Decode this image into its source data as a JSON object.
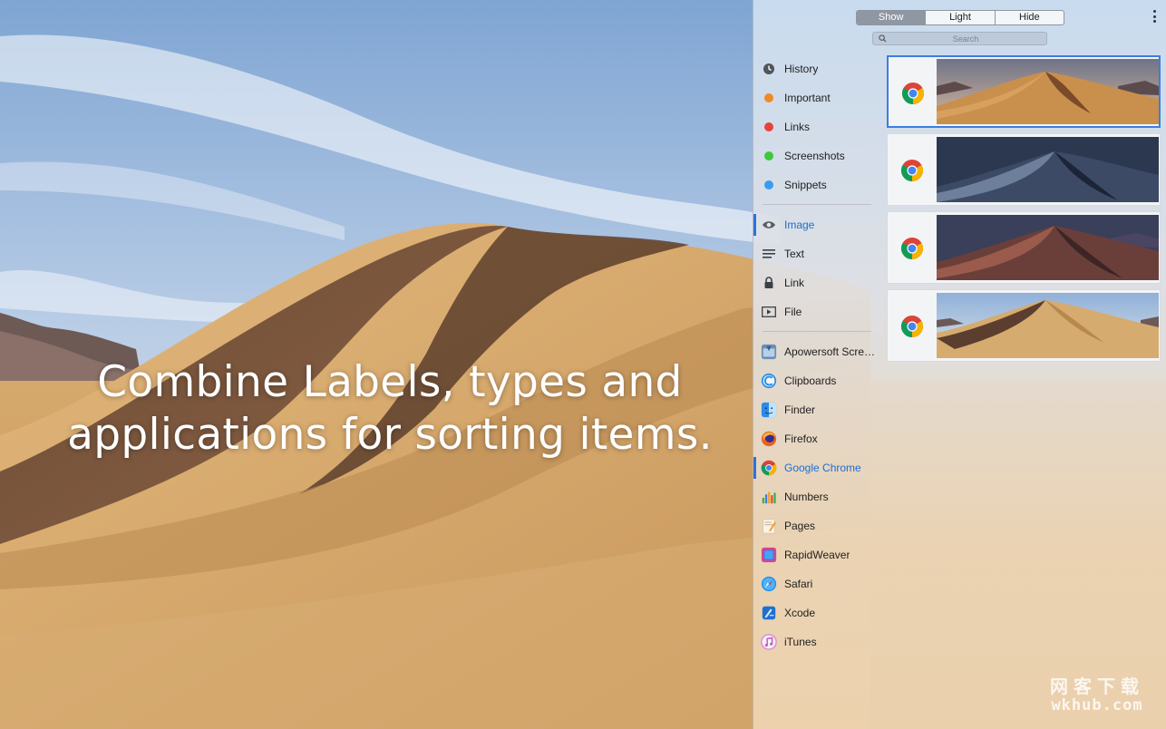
{
  "caption": {
    "line1": "Combine Labels, types and",
    "line2": "applications for sorting items."
  },
  "toolbar": {
    "segments": [
      {
        "label": "Show",
        "active": true
      },
      {
        "label": "Light",
        "active": false
      },
      {
        "label": "Hide",
        "active": false
      }
    ],
    "more_icon": "vertical-ellipsis-icon"
  },
  "search": {
    "placeholder": "Search",
    "icon": "search-icon"
  },
  "labels": [
    {
      "label": "History",
      "icon": "history-icon",
      "color": "#555a60"
    },
    {
      "label": "Important",
      "icon": "orange-dot-icon",
      "color": "#f08a24"
    },
    {
      "label": "Links",
      "icon": "red-dot-icon",
      "color": "#e8423a"
    },
    {
      "label": "Screenshots",
      "icon": "green-dot-icon",
      "color": "#3fc83a"
    },
    {
      "label": "Snippets",
      "icon": "blue-dot-icon",
      "color": "#3a9cf0"
    }
  ],
  "types": [
    {
      "label": "Image",
      "icon": "eye-icon",
      "active": true
    },
    {
      "label": "Text",
      "icon": "text-lines-icon",
      "active": false
    },
    {
      "label": "Link",
      "icon": "lock-icon",
      "active": false
    },
    {
      "label": "File",
      "icon": "media-file-icon",
      "active": false
    }
  ],
  "apps": [
    {
      "label": "Apowersoft Screen Recorder",
      "icon": "apowersoft-icon",
      "active": false
    },
    {
      "label": "Clipboards",
      "icon": "clipboards-icon",
      "active": false
    },
    {
      "label": "Finder",
      "icon": "finder-icon",
      "active": false
    },
    {
      "label": "Firefox",
      "icon": "firefox-icon",
      "active": false
    },
    {
      "label": "Google Chrome",
      "icon": "chrome-icon",
      "active": true
    },
    {
      "label": "Numbers",
      "icon": "numbers-icon",
      "active": false
    },
    {
      "label": "Pages",
      "icon": "pages-icon",
      "active": false
    },
    {
      "label": "RapidWeaver",
      "icon": "rapidweaver-icon",
      "active": false
    },
    {
      "label": "Safari",
      "icon": "safari-icon",
      "active": false
    },
    {
      "label": "Xcode",
      "icon": "xcode-icon",
      "active": false
    },
    {
      "label": "iTunes",
      "icon": "itunes-icon",
      "active": false
    }
  ],
  "clips": [
    {
      "app_icon": "chrome-icon",
      "thumbnail": "desert-dune-dusk",
      "selected": true
    },
    {
      "app_icon": "chrome-icon",
      "thumbnail": "desert-dune-night",
      "selected": false
    },
    {
      "app_icon": "chrome-icon",
      "thumbnail": "desert-dune-evening",
      "selected": false
    },
    {
      "app_icon": "chrome-icon",
      "thumbnail": "desert-dune-day",
      "selected": false
    }
  ],
  "watermark": {
    "line1": "网客下载",
    "line2": "wkhub.com"
  },
  "colors": {
    "accent": "#2b74d9",
    "segment_active": "#8f97a3"
  }
}
